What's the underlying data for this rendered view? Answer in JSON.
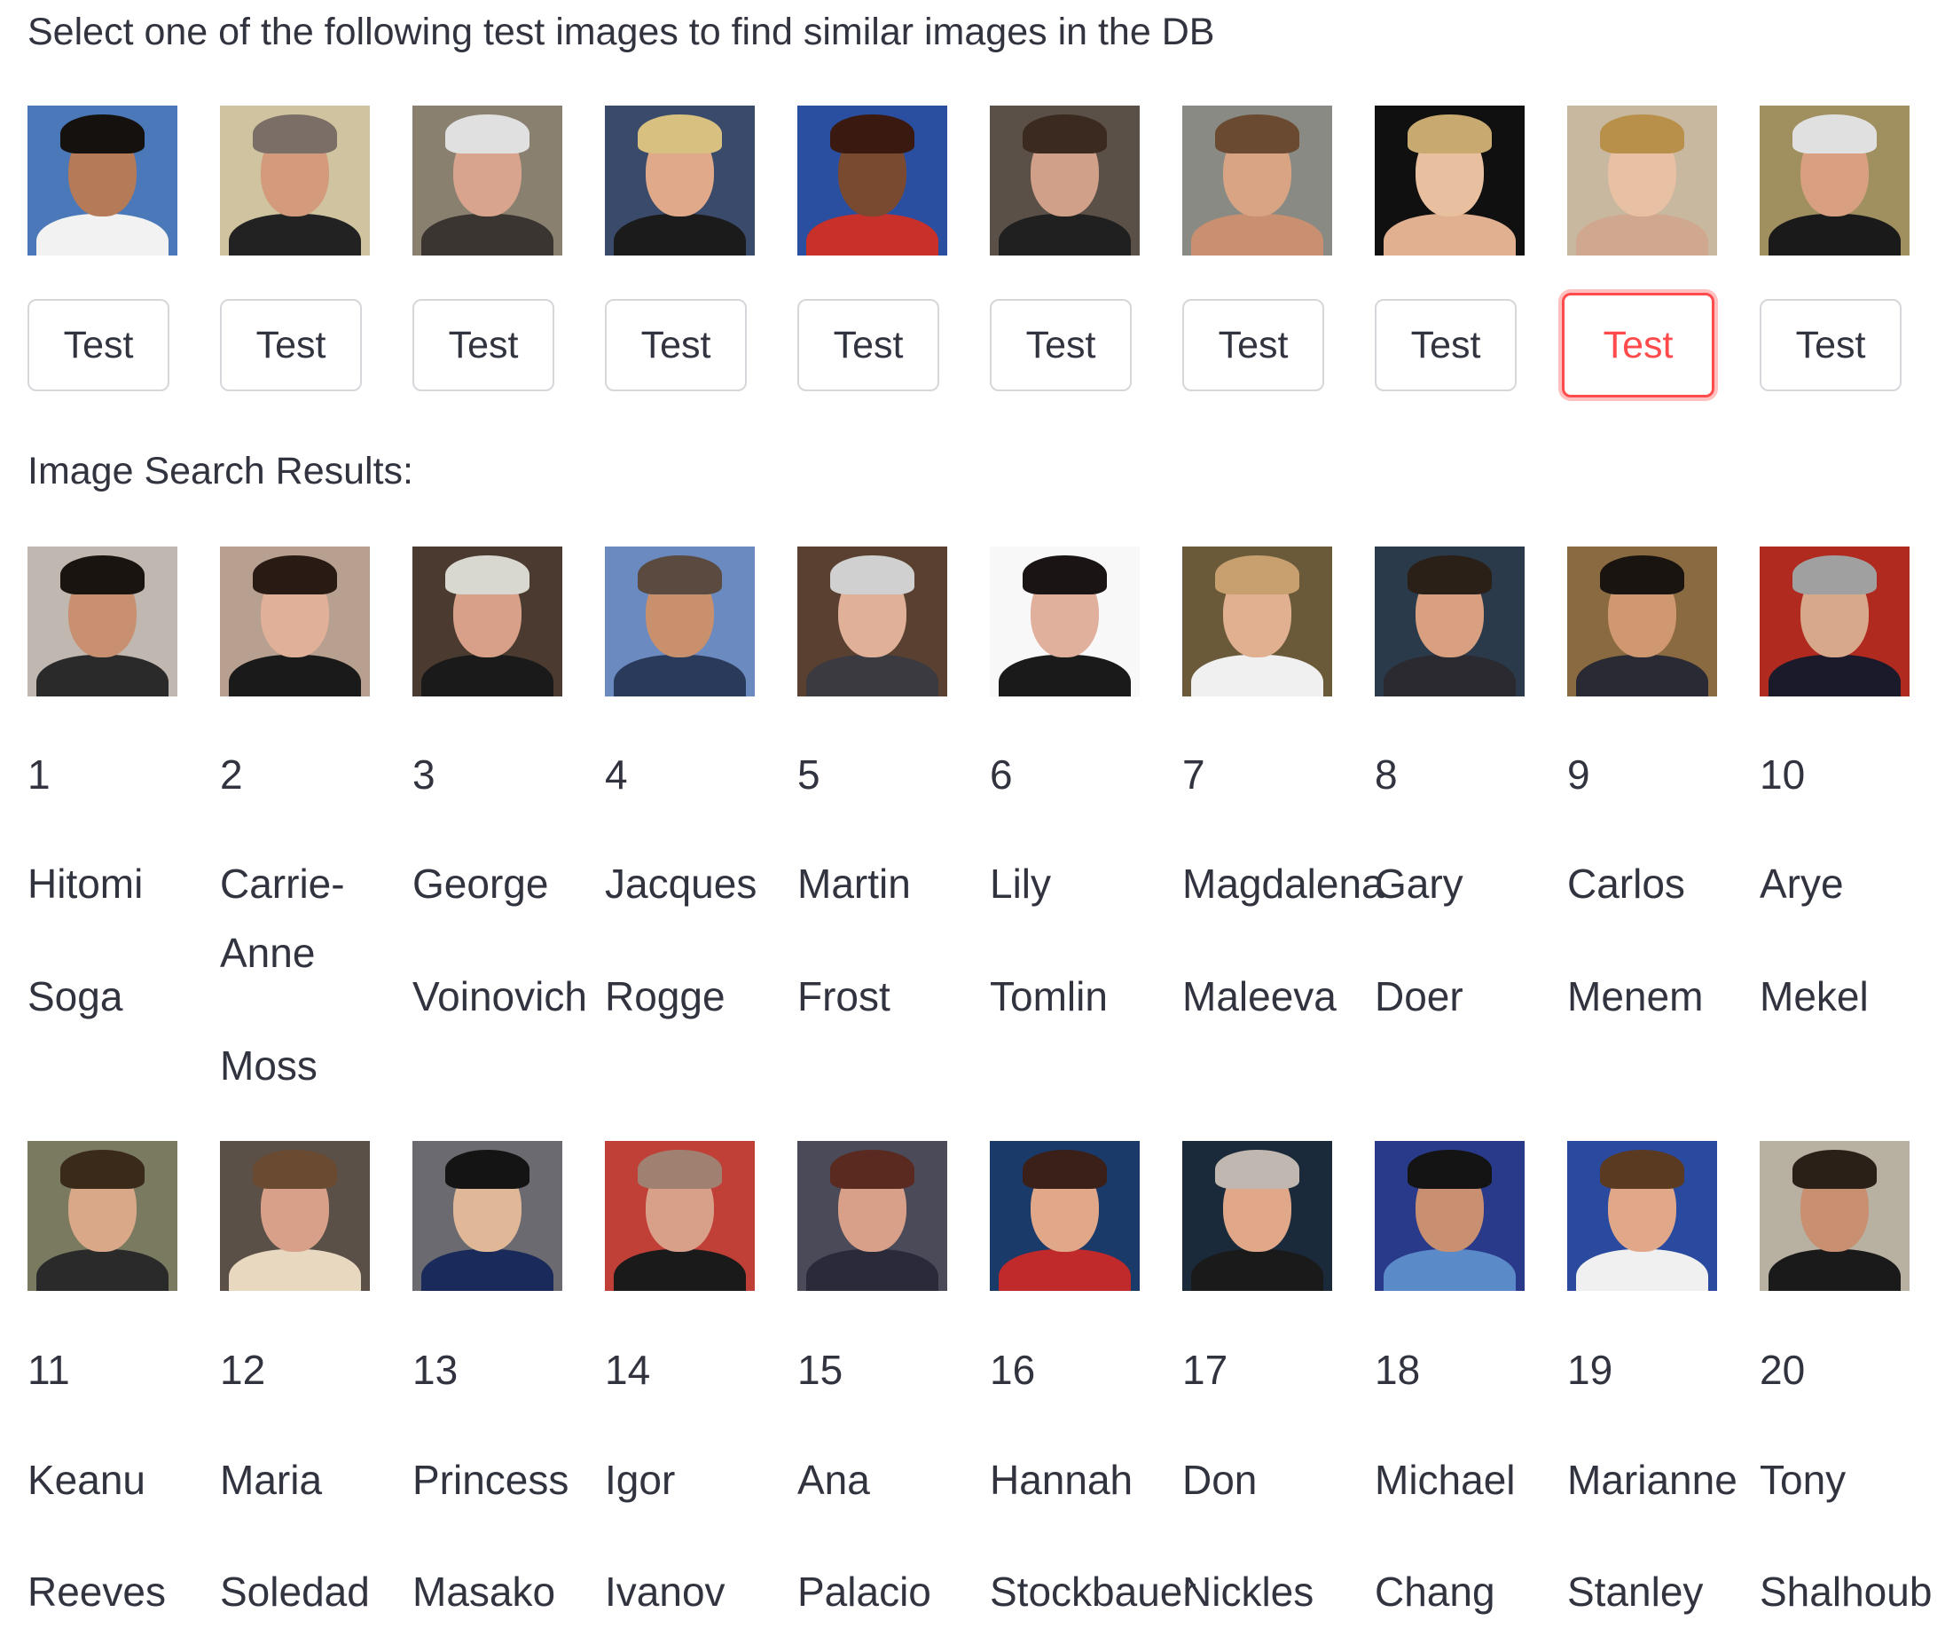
{
  "instruction": "Select one of the following test images to find similar images in the DB",
  "results_heading": "Image Search Results:",
  "test_images": [
    {
      "button_label": "Test",
      "active": false,
      "bg": "#4a78b8",
      "skin": "#b57a58",
      "hair": "#15110e",
      "cloth": "#f2f2f2"
    },
    {
      "button_label": "Test",
      "active": false,
      "bg": "#cfc3a0",
      "skin": "#d39a7c",
      "hair": "#7a6e66",
      "cloth": "#222222"
    },
    {
      "button_label": "Test",
      "active": false,
      "bg": "#8a8070",
      "skin": "#d9a48d",
      "hair": "#e0e0e0",
      "cloth": "#3a3530"
    },
    {
      "button_label": "Test",
      "active": false,
      "bg": "#3a4a6a",
      "skin": "#e0aa8a",
      "hair": "#d8c080",
      "cloth": "#1b1b1b"
    },
    {
      "button_label": "Test",
      "active": false,
      "bg": "#2a4fa0",
      "skin": "#7a4a30",
      "hair": "#3a1a10",
      "cloth": "#c8302a"
    },
    {
      "button_label": "Test",
      "active": false,
      "bg": "#5a5048",
      "skin": "#d0a088",
      "hair": "#3a2a20",
      "cloth": "#202020"
    },
    {
      "button_label": "Test",
      "active": false,
      "bg": "#8a8a84",
      "skin": "#d8a484",
      "hair": "#6a4a30",
      "cloth": "#c89070"
    },
    {
      "button_label": "Test",
      "active": false,
      "bg": "#101010",
      "skin": "#e8c0a0",
      "hair": "#c8aa70",
      "cloth": "#e0b090"
    },
    {
      "button_label": "Test",
      "active": true,
      "bg": "#c8b8a0",
      "skin": "#e8c0a4",
      "hair": "#b8904a",
      "cloth": "#d0a890"
    },
    {
      "button_label": "Test",
      "active": false,
      "bg": "#a09060",
      "skin": "#d8a080",
      "hair": "#e0e0e0",
      "cloth": "#1a1a1a"
    }
  ],
  "results": [
    {
      "rank": "1",
      "first_name": "Hitomi",
      "last_name": "Soga",
      "bg": "#c0b8b0",
      "skin": "#c89070",
      "hair": "#1a1410",
      "cloth": "#2a2a2a"
    },
    {
      "rank": "2",
      "first_name": "Carrie-Anne",
      "last_name": "Moss",
      "bg": "#b8a090",
      "skin": "#e0b098",
      "hair": "#2a1a14",
      "cloth": "#1a1a1a"
    },
    {
      "rank": "3",
      "first_name": "George",
      "last_name": "Voinovich",
      "bg": "#4a3a30",
      "skin": "#d8a088",
      "hair": "#d8d8d0",
      "cloth": "#1a1a1a"
    },
    {
      "rank": "4",
      "first_name": "Jacques",
      "last_name": "Rogge",
      "bg": "#6a8ac0",
      "skin": "#c8906c",
      "hair": "#5a4a40",
      "cloth": "#2a3a5a"
    },
    {
      "rank": "5",
      "first_name": "Martin",
      "last_name": "Frost",
      "bg": "#5a4030",
      "skin": "#e0b098",
      "hair": "#d0d0d0",
      "cloth": "#3a3a40"
    },
    {
      "rank": "6",
      "first_name": "Lily",
      "last_name": "Tomlin",
      "bg": "#f8f8f8",
      "skin": "#e0b09c",
      "hair": "#1a1414",
      "cloth": "#1a1a1a"
    },
    {
      "rank": "7",
      "first_name": "Magdalena",
      "last_name": "Maleeva",
      "bg": "#6a5a3a",
      "skin": "#e0b090",
      "hair": "#c8a070",
      "cloth": "#f0f0f0"
    },
    {
      "rank": "8",
      "first_name": "Gary",
      "last_name": "Doer",
      "bg": "#2a3a4a",
      "skin": "#d8a080",
      "hair": "#2a2018",
      "cloth": "#2a2a30"
    },
    {
      "rank": "9",
      "first_name": "Carlos",
      "last_name": "Menem",
      "bg": "#8a6a40",
      "skin": "#d09870",
      "hair": "#1a1410",
      "cloth": "#2a2a34"
    },
    {
      "rank": "10",
      "first_name": "Arye",
      "last_name": "Mekel",
      "bg": "#b02a20",
      "skin": "#d8a88a",
      "hair": "#a0a0a0",
      "cloth": "#1a1a2a"
    },
    {
      "rank": "11",
      "first_name": "Keanu",
      "last_name": "Reeves",
      "bg": "#7a7a60",
      "skin": "#d8a888",
      "hair": "#3a2a1a",
      "cloth": "#2a2a2a"
    },
    {
      "rank": "12",
      "first_name": "Maria",
      "last_name": "Soledad",
      "bg": "#5a5048",
      "skin": "#d8a088",
      "hair": "#6a4a30",
      "cloth": "#e8d8c0"
    },
    {
      "rank": "13",
      "first_name": "Princess",
      "last_name": "Masako",
      "bg": "#6a6a70",
      "skin": "#e0b898",
      "hair": "#141414",
      "cloth": "#1a2a5a"
    },
    {
      "rank": "14",
      "first_name": "Igor",
      "last_name": "Ivanov",
      "bg": "#c04038",
      "skin": "#d8a088",
      "hair": "#a08070",
      "cloth": "#1a1a1a"
    },
    {
      "rank": "15",
      "first_name": "Ana",
      "last_name": "Palacio",
      "bg": "#4a4a58",
      "skin": "#d8a088",
      "hair": "#5a2a20",
      "cloth": "#2a2a3a"
    },
    {
      "rank": "16",
      "first_name": "Hannah",
      "last_name": "Stockbauer",
      "bg": "#1a3a6a",
      "skin": "#e0a888",
      "hair": "#3a2018",
      "cloth": "#c02a2a"
    },
    {
      "rank": "17",
      "first_name": "Don",
      "last_name": "Nickles",
      "bg": "#1a2a3a",
      "skin": "#e0a888",
      "hair": "#c0b8b0",
      "cloth": "#1a1a1a"
    },
    {
      "rank": "18",
      "first_name": "Michael",
      "last_name": "Chang",
      "bg": "#2a3a8a",
      "skin": "#c89070",
      "hair": "#141414",
      "cloth": "#5a8ac8"
    },
    {
      "rank": "19",
      "first_name": "Marianne",
      "last_name": "Stanley",
      "bg": "#2a4aa0",
      "skin": "#e0a888",
      "hair": "#5a3a20",
      "cloth": "#f0f0f0"
    },
    {
      "rank": "20",
      "first_name": "Tony",
      "last_name": "Shalhoub",
      "bg": "#b8b0a0",
      "skin": "#c89070",
      "hair": "#2a2018",
      "cloth": "#1a1a1a"
    }
  ]
}
